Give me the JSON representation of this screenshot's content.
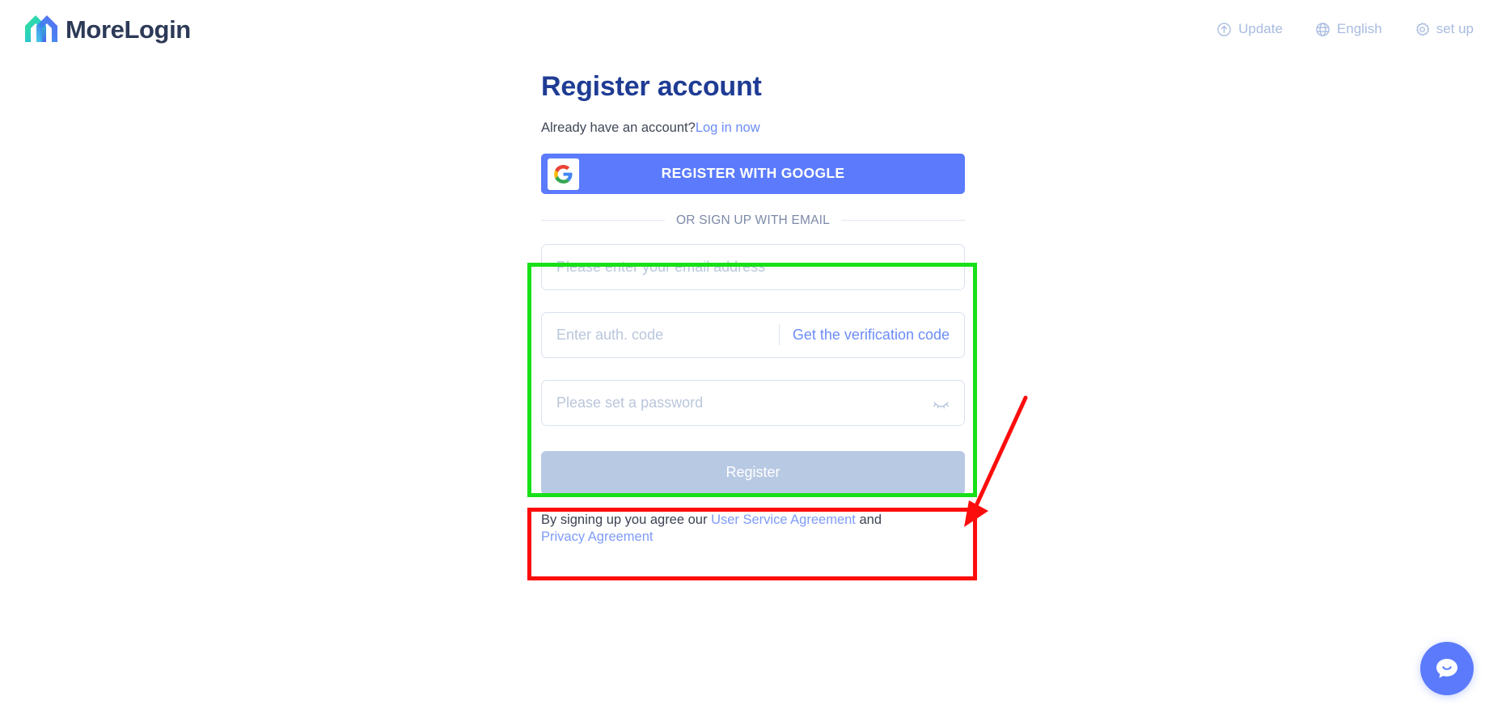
{
  "header": {
    "brand_name": "MoreLogin",
    "brand_icon": "morelogin-logo-icon",
    "nav": [
      {
        "label": "Update",
        "icon": "arrow-up-circle-icon"
      },
      {
        "label": "English",
        "icon": "globe-icon"
      },
      {
        "label": "set up",
        "icon": "gear-icon"
      }
    ]
  },
  "main": {
    "title": "Register account",
    "already_text": "Already have an account?",
    "login_link": "Log in now",
    "google_button": {
      "label": "REGISTER WITH GOOGLE",
      "icon": "google-g-icon"
    },
    "divider_label": "OR SIGN UP WITH EMAIL",
    "fields": {
      "email": {
        "placeholder": "Please enter your email address",
        "value": ""
      },
      "auth_code": {
        "placeholder": "Enter auth. code",
        "value": "",
        "action_label": "Get the verification code"
      },
      "password": {
        "placeholder": "Please set a password",
        "value": "",
        "toggle_icon": "eye-off-icon"
      }
    },
    "submit_label": "Register",
    "agreement": {
      "prefix": "By signing up you agree our ",
      "link1": "User Service Agreement",
      "middle": " and",
      "link2": "Privacy Agreement"
    }
  },
  "chat_widget": {
    "icon": "chat-bubble-smile-icon"
  },
  "annotations": {
    "green_box_target": "email-authcode-password-fields",
    "red_box_target": "register-button",
    "arrow": "red-arrow-pointing-to-register-button"
  },
  "colors": {
    "brand_blue": "#5b7bfc",
    "title_navy": "#1f3c94",
    "link_blue": "#6b8cf7",
    "disabled_button": "#b8c9e3",
    "annotation_green": "#18e018",
    "annotation_red": "#fc0d0d",
    "nav_text": "#a8bbe0"
  }
}
